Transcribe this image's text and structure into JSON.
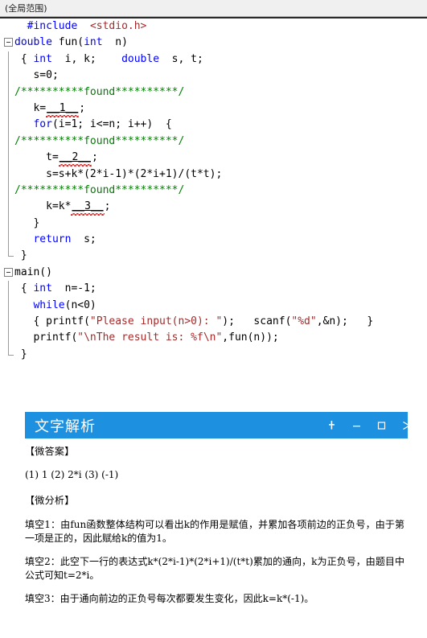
{
  "scope_bar": {
    "label": "(全局范围)"
  },
  "editor": {
    "lines": [
      {
        "indent": 0,
        "fold": false,
        "guide": "none",
        "segments": [
          {
            "t": "  ",
            "c": "plain"
          },
          {
            "t": "#include",
            "c": "pre"
          },
          {
            "t": "  ",
            "c": "plain"
          },
          {
            "t": "<stdio.h>",
            "c": "inc-file"
          }
        ]
      },
      {
        "indent": 0,
        "fold": true,
        "guide": "none",
        "segments": [
          {
            "t": "double",
            "c": "kw"
          },
          {
            "t": " fun(",
            "c": "plain"
          },
          {
            "t": "int",
            "c": "kw"
          },
          {
            "t": "  n)",
            "c": "plain"
          }
        ]
      },
      {
        "indent": 0,
        "fold": false,
        "guide": "line",
        "segments": [
          {
            "t": " { ",
            "c": "plain"
          },
          {
            "t": "int",
            "c": "kw"
          },
          {
            "t": "  i, k;    ",
            "c": "plain"
          },
          {
            "t": "double",
            "c": "kw"
          },
          {
            "t": "  s, t;",
            "c": "plain"
          }
        ]
      },
      {
        "indent": 0,
        "fold": false,
        "guide": "line",
        "segments": [
          {
            "t": "   s=0;",
            "c": "plain"
          }
        ]
      },
      {
        "indent": 0,
        "fold": false,
        "guide": "line",
        "segments": [
          {
            "t": "/**********found**********/",
            "c": "cmt"
          }
        ]
      },
      {
        "indent": 0,
        "fold": false,
        "guide": "line",
        "segments": [
          {
            "t": "   k=",
            "c": "plain"
          },
          {
            "t": "__1__",
            "c": "blank"
          },
          {
            "t": ";",
            "c": "plain"
          }
        ]
      },
      {
        "indent": 0,
        "fold": false,
        "guide": "line",
        "segments": [
          {
            "t": "   ",
            "c": "plain"
          },
          {
            "t": "for",
            "c": "kw"
          },
          {
            "t": "(i=1; i<=n; i++)  {",
            "c": "plain"
          }
        ]
      },
      {
        "indent": 0,
        "fold": false,
        "guide": "line",
        "segments": [
          {
            "t": "/**********found**********/",
            "c": "cmt"
          }
        ]
      },
      {
        "indent": 0,
        "fold": false,
        "guide": "line",
        "segments": [
          {
            "t": "     t=",
            "c": "plain"
          },
          {
            "t": "__2__",
            "c": "blank"
          },
          {
            "t": ";",
            "c": "plain"
          }
        ]
      },
      {
        "indent": 0,
        "fold": false,
        "guide": "line",
        "segments": [
          {
            "t": "     s=s+k*(2*i-1)*(2*i+1)/(t*t);",
            "c": "plain"
          }
        ]
      },
      {
        "indent": 0,
        "fold": false,
        "guide": "line",
        "segments": [
          {
            "t": "/**********found**********/",
            "c": "cmt"
          }
        ]
      },
      {
        "indent": 0,
        "fold": false,
        "guide": "line",
        "segments": [
          {
            "t": "     k=k*",
            "c": "plain"
          },
          {
            "t": "__3__",
            "c": "blank"
          },
          {
            "t": ";",
            "c": "plain"
          }
        ]
      },
      {
        "indent": 0,
        "fold": false,
        "guide": "line",
        "segments": [
          {
            "t": "   }",
            "c": "plain"
          }
        ]
      },
      {
        "indent": 0,
        "fold": false,
        "guide": "line",
        "segments": [
          {
            "t": "   ",
            "c": "plain"
          },
          {
            "t": "return",
            "c": "kw"
          },
          {
            "t": "  s;",
            "c": "plain"
          }
        ]
      },
      {
        "indent": 0,
        "fold": false,
        "guide": "end",
        "segments": [
          {
            "t": " }",
            "c": "plain"
          }
        ]
      },
      {
        "indent": 0,
        "fold": true,
        "guide": "none",
        "segments": [
          {
            "t": "main()",
            "c": "plain"
          }
        ]
      },
      {
        "indent": 0,
        "fold": false,
        "guide": "line",
        "segments": [
          {
            "t": " { ",
            "c": "plain"
          },
          {
            "t": "int",
            "c": "kw"
          },
          {
            "t": "  n=-1;",
            "c": "plain"
          }
        ]
      },
      {
        "indent": 0,
        "fold": false,
        "guide": "line",
        "segments": [
          {
            "t": "   ",
            "c": "plain"
          },
          {
            "t": "while",
            "c": "kw"
          },
          {
            "t": "(n<0)",
            "c": "plain"
          }
        ]
      },
      {
        "indent": 0,
        "fold": false,
        "guide": "line",
        "segments": [
          {
            "t": "   { printf(",
            "c": "plain"
          },
          {
            "t": "\"Please input(n>0): \"",
            "c": "str"
          },
          {
            "t": ");   scanf(",
            "c": "plain"
          },
          {
            "t": "\"%d\"",
            "c": "str"
          },
          {
            "t": ",&n);   }",
            "c": "plain"
          }
        ]
      },
      {
        "indent": 0,
        "fold": false,
        "guide": "line",
        "segments": [
          {
            "t": "   printf(",
            "c": "plain"
          },
          {
            "t": "\"\\nThe result is: %f\\n\"",
            "c": "str"
          },
          {
            "t": ",fun(n));",
            "c": "plain"
          }
        ]
      },
      {
        "indent": 0,
        "fold": false,
        "guide": "end",
        "segments": [
          {
            "t": " }",
            "c": "plain"
          }
        ]
      }
    ]
  },
  "panel": {
    "title": "文字解析",
    "accent_color": "#1e90e0",
    "controls": [
      {
        "name": "pin",
        "glyph": "pin"
      },
      {
        "name": "minimize",
        "glyph": "minus"
      },
      {
        "name": "maximize",
        "glyph": "square"
      },
      {
        "name": "close",
        "glyph": "cross"
      }
    ]
  },
  "analysis": {
    "answer_heading": "【微答案】",
    "answer_text": "(1) 1 (2) 2*i (3) (-1)",
    "analysis_heading": "【微分析】",
    "paragraphs": [
      "填空1：由fun函数整体结构可以看出k的作用是赋值，并累加各项前边的正负号，由于第一项是正的，因此赋给k的值为1。",
      "填空2：此空下一行的表达式k*(2*i-1)*(2*i+1)/(t*t)累加的通向，k为正负号，由题目中公式可知t=2*i。",
      "填空3：由于通向前边的正负号每次都要发生变化，因此k=k*(-1)。"
    ]
  }
}
